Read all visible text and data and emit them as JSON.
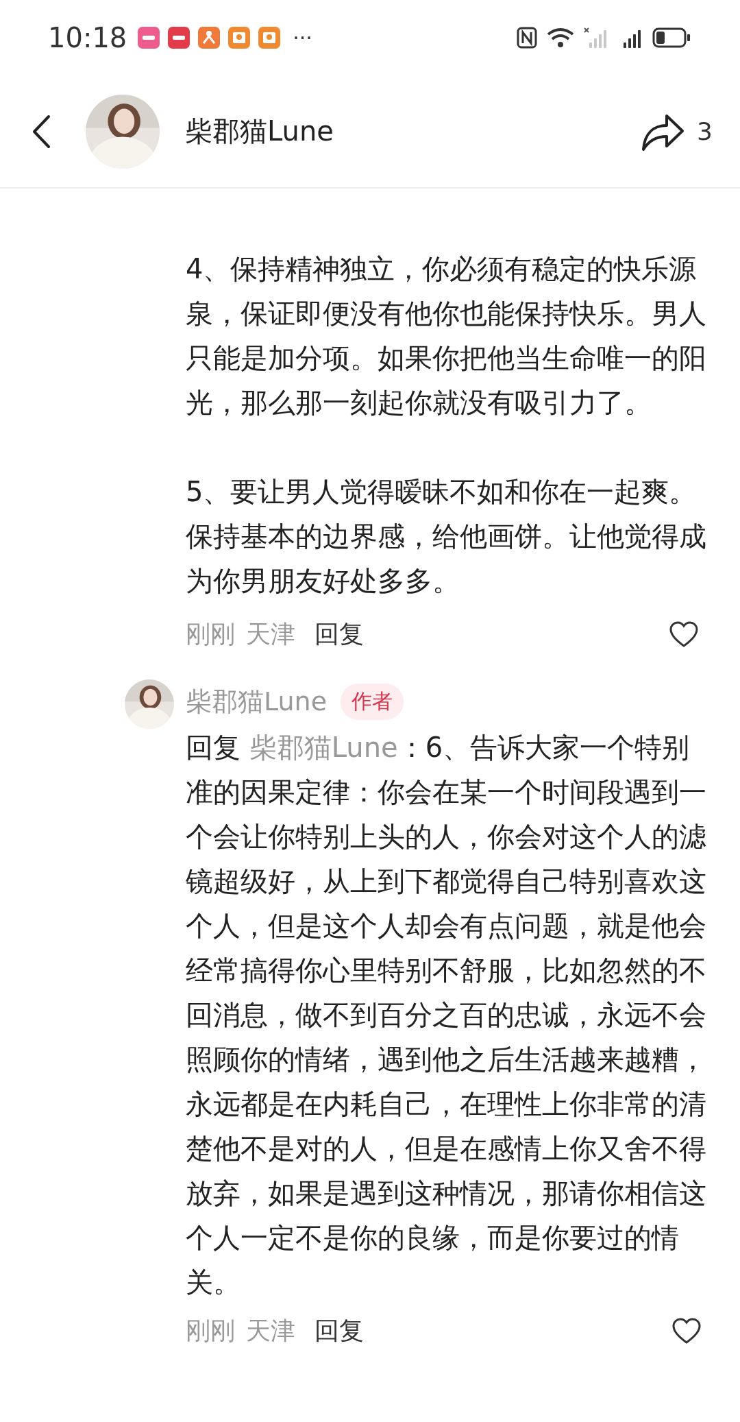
{
  "status_bar": {
    "time": "10:18",
    "notifications": [
      {
        "kind": "pink"
      },
      {
        "kind": "red"
      },
      {
        "kind": "orange"
      },
      {
        "kind": "envelope"
      },
      {
        "kind": "envelope"
      }
    ],
    "more": "···"
  },
  "header": {
    "title": "柴郡猫Lune",
    "share_count": "3"
  },
  "comment": {
    "paragraphs": [
      "4、保持精神独立，你必须有稳定的快乐源泉，保证即便没有他你也能保持快乐。男人只能是加分项。如果你把他当生命唯一的阳光，那么那一刻起你就没有吸引力了。",
      "5、要让男人觉得暧昧不如和你在一起爽。保持基本的边界感，给他画饼。让他觉得成为你男朋友好处多多。"
    ],
    "time": "刚刚",
    "location": "天津",
    "reply_label": "回复",
    "liked": false
  },
  "reply": {
    "author": "柴郡猫Lune",
    "badge": "作者",
    "prefix": "回复",
    "mention": "柴郡猫Lune",
    "text": "：6、告诉大家一个特别准的因果定律：你会在某一个时间段遇到一个会让你特别上头的人，你会对这个人的滤镜超级好，从上到下都觉得自己特别喜欢这个人，但是这个人却会有点问题，就是他会经常搞得你心里特别不舒服，比如忽然的不回消息，做不到百分之百的忠诚，永远不会照顾你的情绪，遇到他之后生活越来越糟，永远都是在内耗自己，在理性上你非常的清楚他不是对的人，但是在感情上你又舍不得放弃，如果是遇到这种情况，那请你相信这个人一定不是你的良缘，而是你要过的情关。",
    "time": "刚刚",
    "location": "天津",
    "reply_label": "回复",
    "liked": false
  }
}
